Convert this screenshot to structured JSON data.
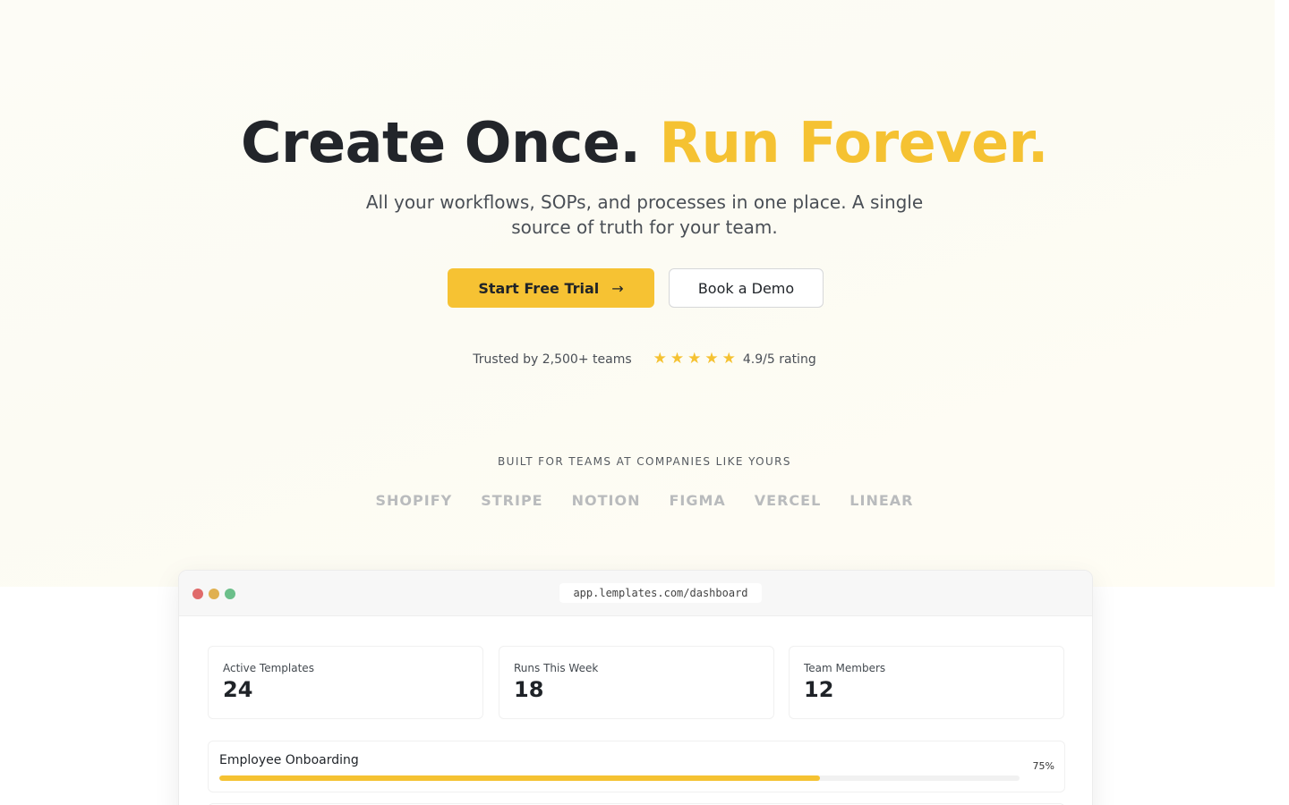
{
  "hero": {
    "headline_dark": "Create Once.",
    "headline_accent": "Run Forever.",
    "subtitle": "All your workflows, SOPs, and processes in one place. A single source of truth for your team.",
    "primary_cta": "Start Free Trial",
    "primary_cta_icon": "arrow-right-icon",
    "secondary_cta": "Book a Demo",
    "trusted_text": "Trusted by 2,500+ teams",
    "rating_stars": 5,
    "rating_text": "4.9/5 rating"
  },
  "social_proof": {
    "label": "BUILT FOR TEAMS AT COMPANIES LIKE YOURS",
    "logos": [
      "SHOPIFY",
      "STRIPE",
      "NOTION",
      "FIGMA",
      "VERCEL",
      "LINEAR"
    ]
  },
  "app_preview": {
    "url": "app.lemplates.com/dashboard",
    "stats": [
      {
        "label": "Active Templates",
        "value": "24"
      },
      {
        "label": "Runs This Week",
        "value": "18"
      },
      {
        "label": "Team Members",
        "value": "12"
      }
    ],
    "progress": {
      "title": "Employee Onboarding",
      "percent_label": "75%",
      "fraction": 0.75
    }
  },
  "colors": {
    "accent": "#f5c232",
    "text": "#1f2328",
    "muted_logo": "#b9bbbd"
  }
}
